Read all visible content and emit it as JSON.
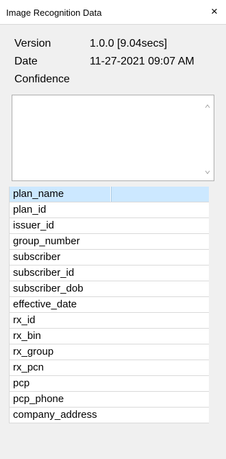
{
  "window": {
    "title": "Image Recognition Data",
    "close_symbol": "×"
  },
  "info": {
    "version_label": "Version",
    "version_value": "1.0.0  [9.04secs]",
    "date_label": "Date",
    "date_value": "11-27-2021 09:07 AM",
    "confidence_label": "Confidence"
  },
  "memo": {
    "text": ""
  },
  "fields": [
    {
      "name": "plan_name",
      "value": ""
    },
    {
      "name": "plan_id",
      "value": ""
    },
    {
      "name": "issuer_id",
      "value": ""
    },
    {
      "name": "group_number",
      "value": ""
    },
    {
      "name": "subscriber",
      "value": ""
    },
    {
      "name": "subscriber_id",
      "value": ""
    },
    {
      "name": "subscriber_dob",
      "value": ""
    },
    {
      "name": "effective_date",
      "value": ""
    },
    {
      "name": "rx_id",
      "value": ""
    },
    {
      "name": "rx_bin",
      "value": ""
    },
    {
      "name": "rx_group",
      "value": ""
    },
    {
      "name": "rx_pcn",
      "value": ""
    },
    {
      "name": "pcp",
      "value": ""
    },
    {
      "name": "pcp_phone",
      "value": ""
    },
    {
      "name": "company_address",
      "value": ""
    }
  ],
  "selected_index": 0
}
